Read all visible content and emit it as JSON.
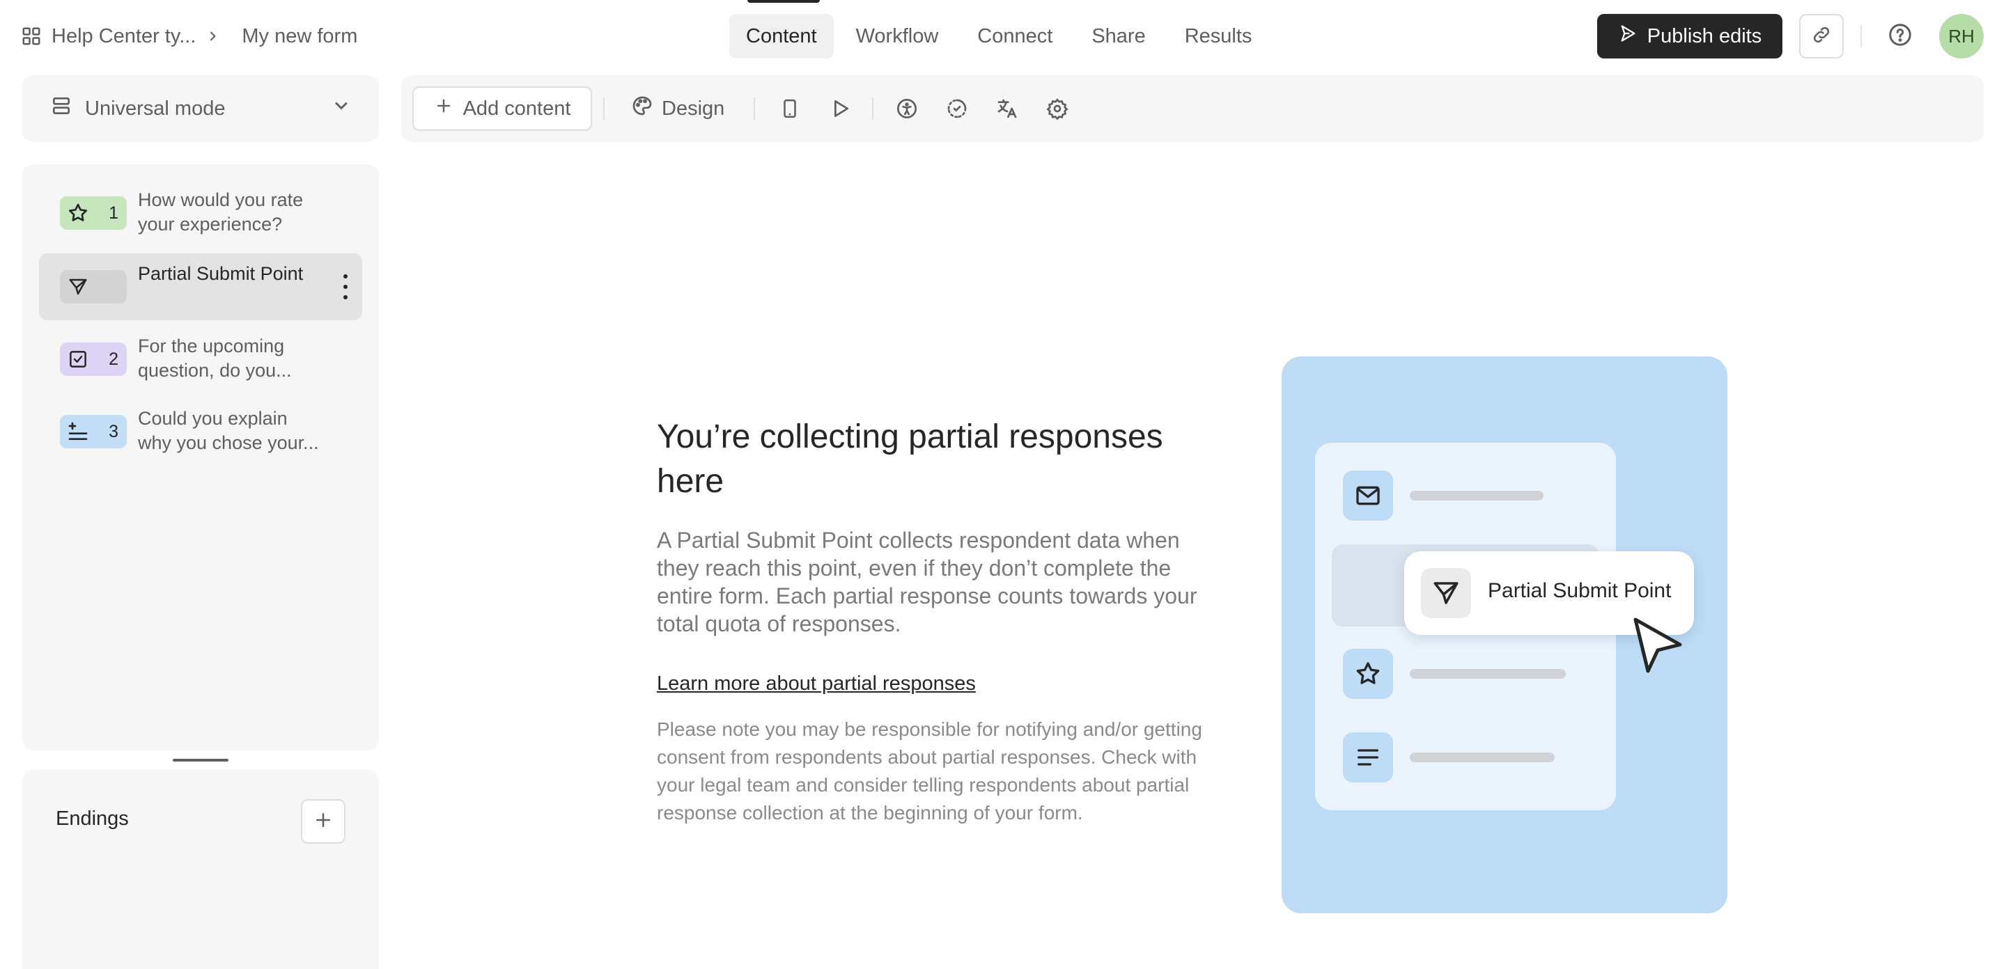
{
  "breadcrumb": {
    "workspace": "Help Center ty...",
    "form": "My new form"
  },
  "tabs": [
    {
      "label": "Content",
      "active": true
    },
    {
      "label": "Workflow",
      "active": false
    },
    {
      "label": "Connect",
      "active": false
    },
    {
      "label": "Share",
      "active": false
    },
    {
      "label": "Results",
      "active": false
    }
  ],
  "header": {
    "publish_label": "Publish edits",
    "avatar_initials": "RH"
  },
  "mode_selector": {
    "label": "Universal mode"
  },
  "questions": [
    {
      "number": "1",
      "text": "How would you rate your experience?",
      "icon": "star-icon",
      "color": "#c7e6bd",
      "selected": false
    },
    {
      "number": "",
      "text": "Partial Submit Point",
      "icon": "send-icon",
      "color": "#d3d3d3",
      "selected": true
    },
    {
      "number": "2",
      "text": "For the upcoming question, do you...",
      "icon": "checkbox-icon",
      "color": "#dcd3f5",
      "selected": false
    },
    {
      "number": "3",
      "text": "Could you explain why you chose your...",
      "icon": "long-text-icon",
      "color": "#c3def7",
      "selected": false
    }
  ],
  "endings": {
    "title": "Endings"
  },
  "toolbar": {
    "add_content_label": "Add content",
    "design_label": "Design"
  },
  "main": {
    "heading": "You’re collecting partial responses here",
    "description": "A Partial Submit Point collects respondent data when they reach this point, even if they don’t complete the entire form. Each partial response counts towards your total quota of responses.",
    "learn_more": "Learn more about partial responses",
    "note": "Please note you may be responsible for notifying and/or getting consent from respondents about partial responses. Check with your legal team and consider telling respondents about partial response collection at the beginning of your form."
  },
  "illustration": {
    "popup_label": "Partial Submit Point"
  },
  "colors": {
    "primary": "#262627",
    "panel_bg": "#f6f6f6",
    "illustration_bg": "#bedcf5",
    "avatar_bg": "#b6dca8"
  }
}
